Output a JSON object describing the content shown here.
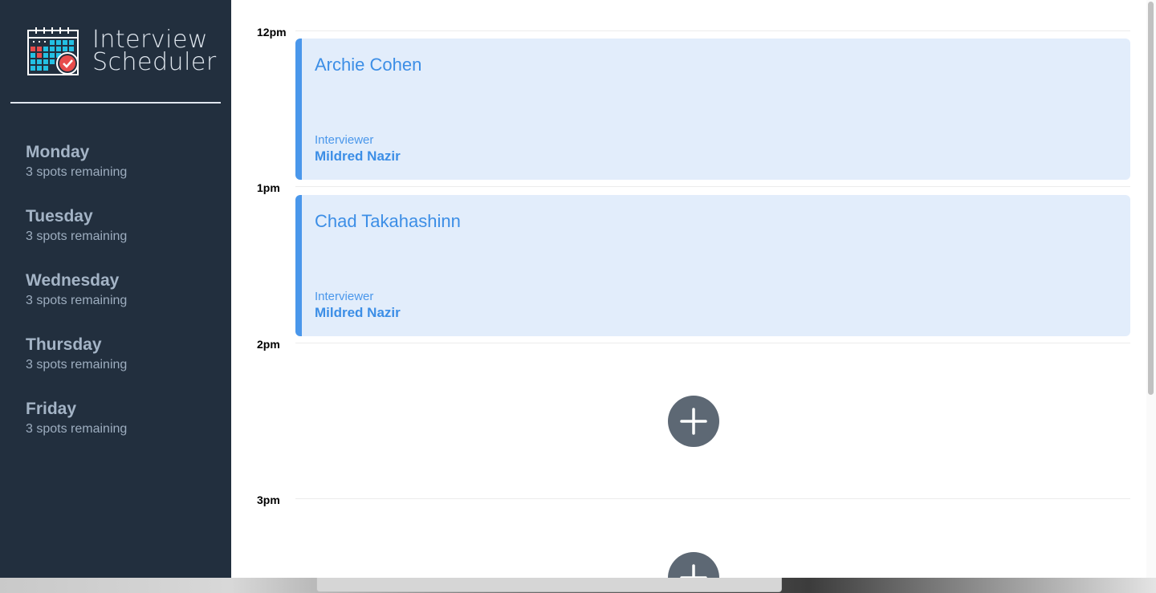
{
  "brand": {
    "title_line1": "Interview",
    "title_line2": "Scheduler"
  },
  "days": [
    {
      "name": "Monday",
      "spots": "3 spots remaining"
    },
    {
      "name": "Tuesday",
      "spots": "3 spots remaining"
    },
    {
      "name": "Wednesday",
      "spots": "3 spots remaining"
    },
    {
      "name": "Thursday",
      "spots": "3 spots remaining"
    },
    {
      "name": "Friday",
      "spots": "3 spots remaining"
    }
  ],
  "schedule": {
    "slots": [
      {
        "time": "12pm",
        "student": "Archie Cohen",
        "interviewer_label": "Interviewer",
        "interviewer": "Mildred Nazir"
      },
      {
        "time": "1pm",
        "student": "Chad Takahashinn",
        "interviewer_label": "Interviewer",
        "interviewer": "Mildred Nazir"
      },
      {
        "time": "2pm"
      },
      {
        "time": "3pm"
      }
    ]
  },
  "colors": {
    "sidebar_bg": "#222f3e",
    "sidebar_text": "#a4b4c6",
    "appointment_bg": "#e2edfb",
    "appointment_accent": "#4a97eb",
    "add_button_bg": "#5d6874"
  },
  "icons": {
    "logo": "calendar-check-icon",
    "add": "plus-icon"
  }
}
